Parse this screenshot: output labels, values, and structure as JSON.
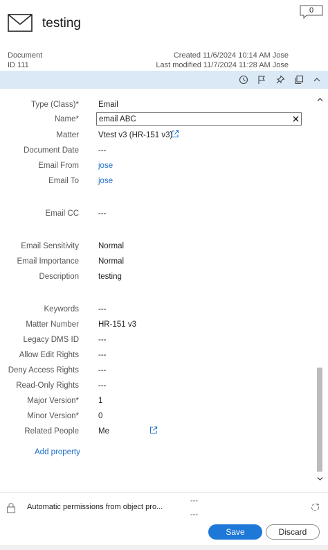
{
  "header": {
    "title": "testing",
    "icon": "mail-icon",
    "comment_count": "0",
    "doc_type": "Document",
    "doc_id": "ID 111",
    "created": "Created 11/6/2024 10:14 AM Jose",
    "modified": "Last modified 11/7/2024 11:28 AM Jose"
  },
  "toolbar": {
    "icons": [
      "history-icon",
      "flag-icon",
      "pin-icon",
      "copy-icon",
      "collapse-icon"
    ],
    "background": "#dbe9f7"
  },
  "properties": {
    "type_class": {
      "label": "Type (Class)*",
      "value": "Email"
    },
    "name": {
      "label": "Name*",
      "value": "email ABC"
    },
    "matter": {
      "label": "Matter",
      "value": "Vtest v3 (HR-151 v3)"
    },
    "document_date": {
      "label": "Document Date",
      "value": "---"
    },
    "email_from": {
      "label": "Email From",
      "value": "jose"
    },
    "email_to": {
      "label": "Email To",
      "value": "jose"
    },
    "email_cc": {
      "label": "Email CC",
      "value": "---"
    },
    "email_sensitivity": {
      "label": "Email Sensitivity",
      "value": "Normal"
    },
    "email_importance": {
      "label": "Email Importance",
      "value": "Normal"
    },
    "description": {
      "label": "Description",
      "value": "testing"
    },
    "keywords": {
      "label": "Keywords",
      "value": "---"
    },
    "matter_number": {
      "label": "Matter Number",
      "value": "HR-151 v3"
    },
    "legacy_dms_id": {
      "label": "Legacy DMS ID",
      "value": "---"
    },
    "allow_edit_rights": {
      "label": "Allow Edit Rights",
      "value": "---"
    },
    "deny_access_rights": {
      "label": "Deny Access Rights",
      "value": "---"
    },
    "read_only_rights": {
      "label": "Read-Only Rights",
      "value": "---"
    },
    "major_version": {
      "label": "Major Version*",
      "value": "1"
    },
    "minor_version": {
      "label": "Minor Version*",
      "value": "0"
    },
    "related_people": {
      "label": "Related People",
      "value": "Me"
    }
  },
  "add_property_label": "Add property",
  "footer": {
    "permissions_text": "Automatic permissions from object pro...",
    "dash_top": "---",
    "dash_bottom": "---",
    "save_label": "Save",
    "discard_label": "Discard"
  },
  "colors": {
    "accent": "#1e78d7",
    "link": "#1f6fc5"
  }
}
